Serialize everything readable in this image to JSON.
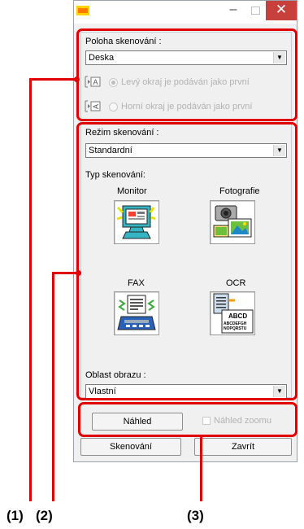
{
  "window": {
    "minimize_label": "–",
    "close_label": "✕"
  },
  "scan_position": {
    "group_label": "Poloha skenování :",
    "selected": "Deska",
    "option_left_edge": "Levý okraj je podáván jako první",
    "option_top_edge": "Horní okraj je podáván jako první"
  },
  "scan_mode": {
    "label": "Režim skenování :",
    "selected": "Standardní"
  },
  "scan_type": {
    "label": "Typ skenování:",
    "items": [
      {
        "label": "Monitor"
      },
      {
        "label": "Fotografie"
      },
      {
        "label": "FAX"
      },
      {
        "label": "OCR"
      }
    ]
  },
  "image_area": {
    "label": "Oblast obrazu :",
    "selected": "Vlastní"
  },
  "preview": {
    "button_label": "Náhled",
    "zoom_checkbox_label": "Náhled zoomu"
  },
  "footer": {
    "scan_button": "Skenování",
    "close_button": "Zavrít"
  },
  "callouts": {
    "one": "(1)",
    "two": "(2)",
    "three": "(3)"
  },
  "colors": {
    "callout_red": "#e10000",
    "window_bg": "#f0f0f0",
    "close_button": "#c8403c"
  }
}
